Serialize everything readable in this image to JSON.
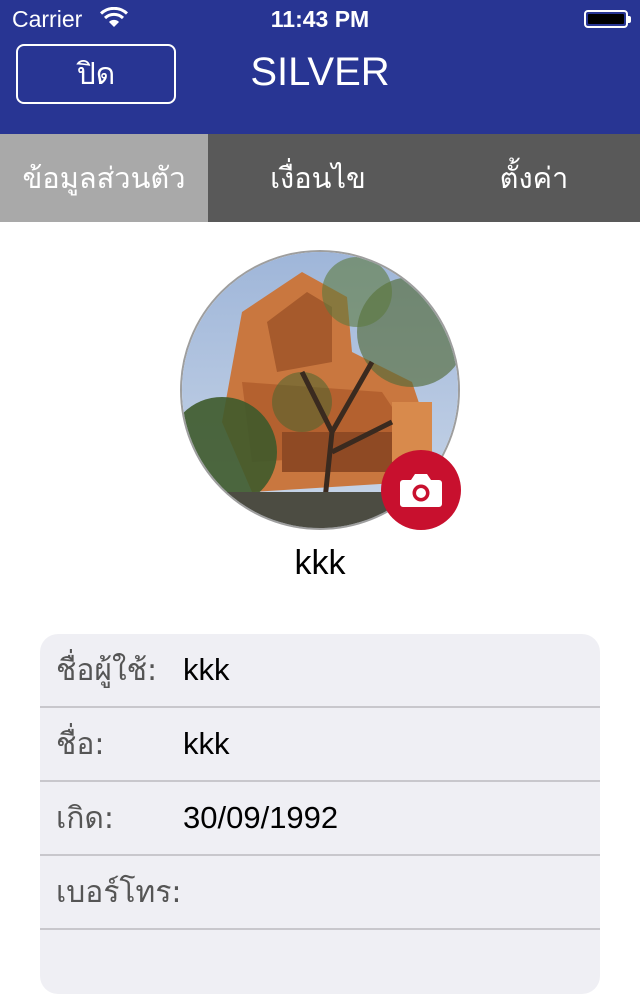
{
  "status_bar": {
    "carrier": "Carrier",
    "time": "11:43 PM"
  },
  "header": {
    "close_label": "ปิด",
    "title": "SILVER"
  },
  "tabs": [
    {
      "label": "ข้อมูลส่วนตัว",
      "active": true
    },
    {
      "label": "เงื่อนไข",
      "active": false
    },
    {
      "label": "ตั้งค่า",
      "active": false
    }
  ],
  "profile": {
    "display_name": "kkk",
    "camera_icon": "camera-icon"
  },
  "fields": [
    {
      "label": "ชื่อผู้ใช้:",
      "value": "kkk"
    },
    {
      "label": "ชื่อ:",
      "value": "kkk"
    },
    {
      "label": "เกิด:",
      "value": "30/09/1992"
    },
    {
      "label": "เบอร์โทร:",
      "value": ""
    }
  ],
  "colors": {
    "header_bg": "#283593",
    "tab_bg": "#595959",
    "tab_active_bg": "#a9a9a9",
    "camera_button": "#c8102e",
    "card_bg": "#efeff4"
  }
}
